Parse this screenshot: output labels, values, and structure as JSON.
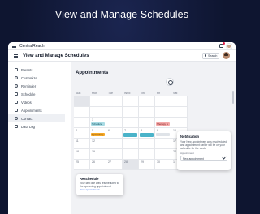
{
  "hero": {
    "title": "View and Manage Schedules"
  },
  "app": {
    "brand": "CentralReach",
    "page_title": "View and Manage Schedules",
    "search_label": "Search"
  },
  "sidebar": {
    "items": [
      {
        "label": "Parents",
        "icon": "home-icon"
      },
      {
        "label": "Customize",
        "icon": "gear-icon"
      },
      {
        "label": "Reminder",
        "icon": "clock-icon"
      },
      {
        "label": "Schedule",
        "icon": "calendar-icon"
      },
      {
        "label": "Videos",
        "icon": "video-icon"
      },
      {
        "label": "Appointments",
        "icon": "list-icon"
      },
      {
        "label": "Contact",
        "icon": "phone-icon",
        "active": true
      },
      {
        "label": "Data Log",
        "icon": "chart-icon"
      }
    ]
  },
  "main": {
    "title": "Appointments",
    "days": [
      "Sun",
      "Mon",
      "Tue",
      "Wed",
      "Thu",
      "Fri",
      "Sat"
    ],
    "weeks": [
      [
        "",
        "",
        "",
        "",
        "",
        "",
        ""
      ],
      [
        "",
        "",
        "",
        "",
        "",
        "",
        ""
      ],
      [
        "",
        "1",
        "",
        "",
        "",
        "",
        ""
      ],
      [
        "4",
        "5",
        "6",
        "7",
        "8",
        "9",
        "10"
      ],
      [
        "11",
        "12",
        "",
        "",
        "",
        "",
        "17"
      ],
      [
        "18",
        "19",
        "",
        "",
        "",
        "",
        "24"
      ],
      [
        "25",
        "26",
        "27",
        "28",
        "29",
        "30",
        "1"
      ]
    ],
    "events": {
      "schedule": "Schedule",
      "upcoming": "Upcoming",
      "therapy": "Therapy & Followup",
      "reminder": "Reminder"
    }
  },
  "reschedule_popup": {
    "title": "Reschedule",
    "text": "Your last one was rescheduled to the upcoming appointment",
    "link": "View appointment"
  },
  "notification_popup": {
    "title": "Notification",
    "body": "Your New appointment was rescheduled and appointment earlier will be on your schedule for the week.",
    "label": "Appointment",
    "select_value": "New appointment"
  }
}
